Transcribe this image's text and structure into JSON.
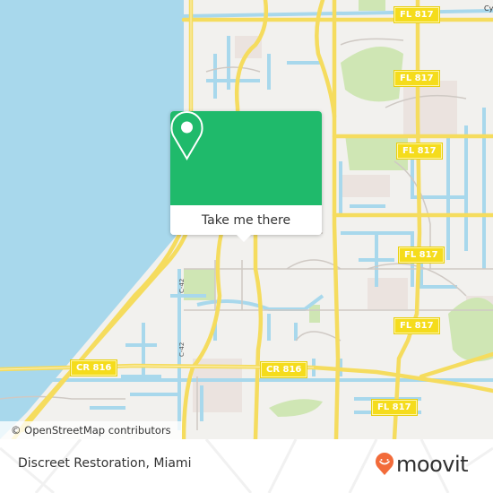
{
  "map": {
    "attribution": "© OpenStreetMap contributors",
    "road_labels": [
      {
        "id": "fl817-a",
        "text": "FL 817"
      },
      {
        "id": "fl817-b",
        "text": "FL 817"
      },
      {
        "id": "fl817-c",
        "text": "FL 817"
      },
      {
        "id": "fl817-d",
        "text": "FL 817"
      },
      {
        "id": "fl817-e",
        "text": "FL 817"
      },
      {
        "id": "fl817-f",
        "text": "FL 817"
      },
      {
        "id": "cr816-a",
        "text": "CR 816"
      },
      {
        "id": "cr816-b",
        "text": "CR 816"
      }
    ],
    "side_labels": [
      "C-42",
      "C-42"
    ],
    "edge_label": "Cy",
    "colors": {
      "land": "#f2f1ee",
      "water": "#a8d8ec",
      "park": "#cfe6b4",
      "residential": "#ebe3df",
      "major_road": "#f7e06a",
      "minor_road": "#cfc9c4"
    }
  },
  "popup": {
    "icon": "map-pin-icon",
    "button_label": "Take me there",
    "accent_color": "#1fba6b"
  },
  "footer": {
    "place_name": "Discreet Restoration, Miami",
    "brand": {
      "icon": "moovit-logo-icon",
      "name": "moovit",
      "color": "#f26b3a"
    }
  }
}
